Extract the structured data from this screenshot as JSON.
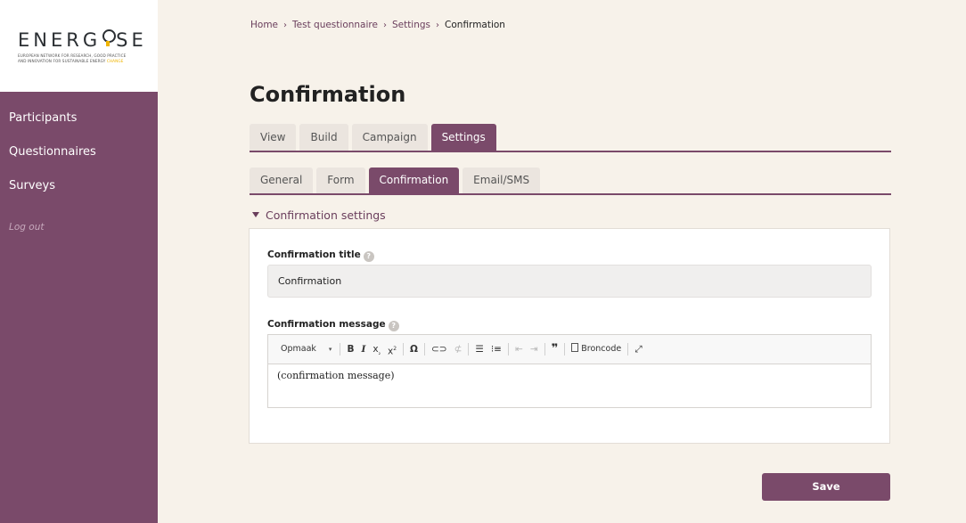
{
  "logo": {
    "word_left": "ENERG",
    "word_right": "SE",
    "tagline_1": "EUROPEAN NETWORK FOR RESEARCH, GOOD PRACTICE",
    "tagline_2": "AND INNOVATION FOR SUSTAINABLE ENERGY",
    "tagline_highlight": "CHANGE"
  },
  "sidebar": {
    "items": [
      {
        "label": "Participants"
      },
      {
        "label": "Questionnaires"
      },
      {
        "label": "Surveys"
      }
    ],
    "logout": "Log out"
  },
  "breadcrumb": {
    "items": [
      "Home",
      "Test questionnaire",
      "Settings"
    ],
    "current": "Confirmation",
    "separator": "›"
  },
  "page_title": "Confirmation",
  "primary_tabs": [
    {
      "label": "View"
    },
    {
      "label": "Build"
    },
    {
      "label": "Campaign"
    },
    {
      "label": "Settings",
      "active": true
    }
  ],
  "secondary_tabs": [
    {
      "label": "General"
    },
    {
      "label": "Form"
    },
    {
      "label": "Confirmation",
      "active": true
    },
    {
      "label": "Email/SMS"
    }
  ],
  "section": {
    "title": "Confirmation settings"
  },
  "fields": {
    "title_label": "Confirmation title",
    "title_value": "Confirmation",
    "message_label": "Confirmation message",
    "message_value": "(confirmation message)",
    "help_glyph": "?"
  },
  "toolbar": {
    "format_label": "Opmaak",
    "source_label": "Broncode"
  },
  "actions": {
    "save_label": "Save"
  },
  "colors": {
    "brand_purple": "#7a4a6a",
    "page_background": "#f7f2ea",
    "logo_accent": "#f0b500"
  }
}
